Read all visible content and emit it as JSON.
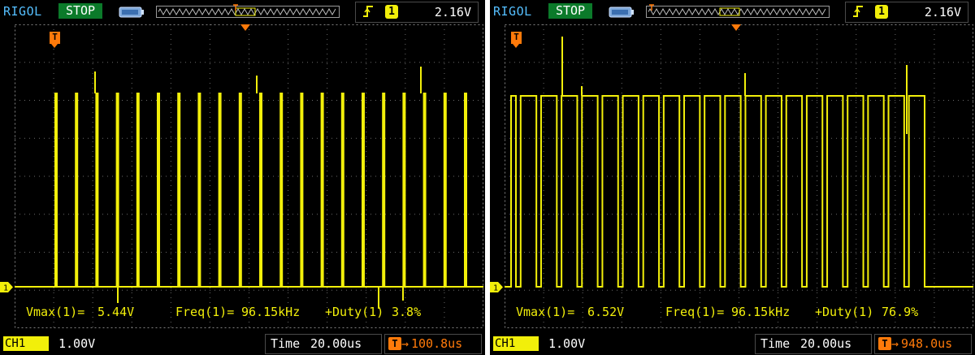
{
  "colors": {
    "trace": "#f2ef0a",
    "grid": "#6a6a6a",
    "trigger": "#ff7a0a",
    "brand": "#55bfff",
    "status_bg": "#0b7a2a"
  },
  "screens": [
    {
      "brand": "RIGOL",
      "status": "STOP",
      "trigger_channel": "1",
      "trigger_level": "2.16V",
      "trigger_marker": "T",
      "waveform": {
        "type": "pwm",
        "duty_percent": 3.8,
        "pulse_count": 21
      },
      "measurements": {
        "vmax_label": "Vmax(1)=",
        "vmax_value": "5.44V",
        "freq_label": "Freq(1)=",
        "freq_value": "96.15kHz",
        "duty_label": "+Duty(1)",
        "duty_value": "3.8%"
      },
      "channel": {
        "name": "CH1",
        "marker": "1",
        "scale": "1.00V"
      },
      "timebase": {
        "label": "Time",
        "value": "20.00us"
      },
      "trigger_offset": {
        "icon": "T",
        "arrow": "→",
        "value": "100.8us"
      }
    },
    {
      "brand": "RIGOL",
      "status": "STOP",
      "trigger_channel": "1",
      "trigger_level": "2.16V",
      "trigger_marker": "T",
      "waveform": {
        "type": "pwm",
        "duty_percent": 76.9,
        "pulse_count": 20
      },
      "measurements": {
        "vmax_label": "Vmax(1)=",
        "vmax_value": "6.52V",
        "freq_label": "Freq(1)=",
        "freq_value": "96.15kHz",
        "duty_label": "+Duty(1)",
        "duty_value": "76.9%"
      },
      "channel": {
        "name": "CH1",
        "marker": "1",
        "scale": "1.00V"
      },
      "timebase": {
        "label": "Time",
        "value": "20.00us"
      },
      "trigger_offset": {
        "icon": "T",
        "arrow": "→",
        "value": "948.0us"
      }
    }
  ]
}
